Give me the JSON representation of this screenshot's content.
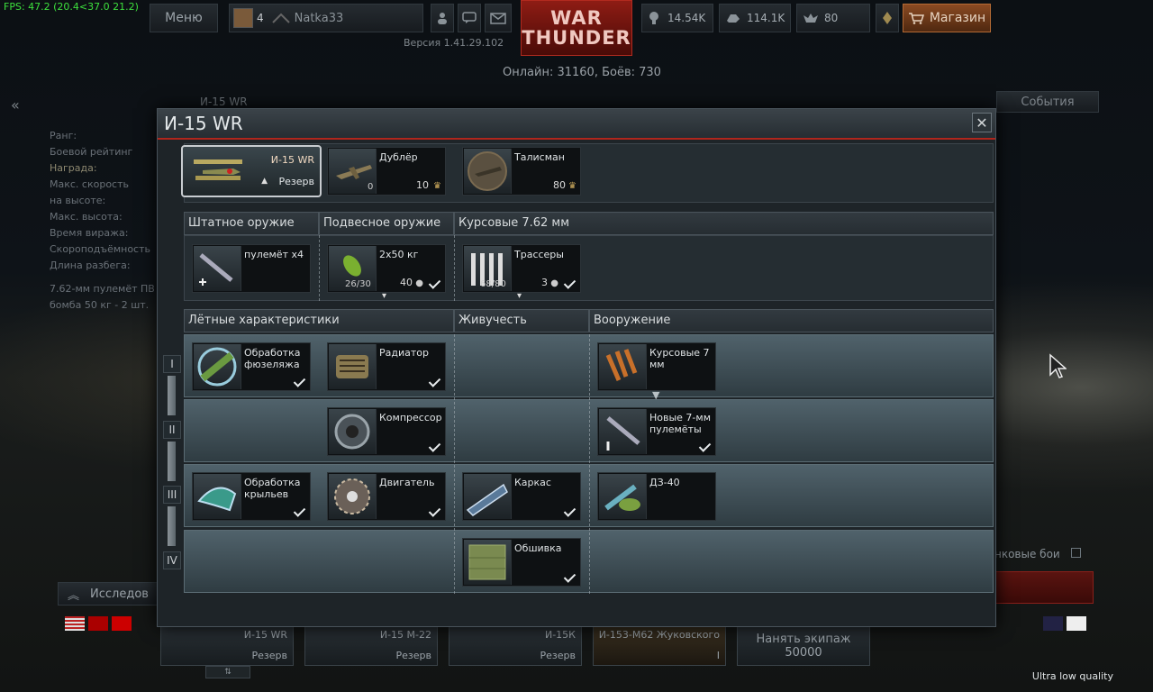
{
  "fps": "FPS: 47.2 (20.4<37.0 21.2)",
  "topbar": {
    "menu": "Меню",
    "rank": "4",
    "player": "Natka33",
    "silver": "14.54K",
    "rp": "114.1K",
    "gold": "80",
    "shop": "Магазин"
  },
  "logo": {
    "line1": "WAR",
    "line2": "THUNDER"
  },
  "version": "Версия 1.41.29.102",
  "online": "Онлайн: 31160, Боёв: 730",
  "background": {
    "breadcrumb": "И-15 WR",
    "events": "События",
    "left_labels": [
      "Ранг:",
      "Боевой рейтинг",
      "Награда:",
      "Макс. скорость",
      "на высоте:",
      "Макс. высота:",
      "Время виража:",
      "Скороподъёмность",
      "Длина разбега:"
    ],
    "left_note1": "7.62-мм пулемёт ПВ",
    "left_note2": "бомба 50 кг - 2 шт.",
    "research": "Исследов",
    "tank_battles": "нковые бои"
  },
  "modal": {
    "title": "И-15 WR",
    "vehicle": {
      "name": "И-15 WR",
      "status": "Резерв"
    },
    "crew": {
      "name": "Дублёр",
      "count": "0",
      "cost": "10"
    },
    "talisman": {
      "name": "Талисман",
      "cost": "80"
    },
    "weapons_headers": [
      "Штатное оружие",
      "Подвесное оружие",
      "Курсовые 7.62 мм"
    ],
    "weapons": {
      "primary": {
        "name": "пулемёт x4"
      },
      "bombs": {
        "name": "2x50 кг",
        "ammo": "26/30",
        "cost": "40"
      },
      "belts": {
        "name": "Трассеры",
        "ammo": "68/80",
        "cost": "3"
      }
    },
    "mod_headers": [
      "Лётные характеристики",
      "Живучесть",
      "Вооружение"
    ],
    "tiers": [
      "I",
      "II",
      "III",
      "IV"
    ],
    "mods": {
      "fuselage": "Обработка фюзеляжа",
      "radiator": "Радиатор",
      "guns7": "Курсовые 7 мм",
      "compressor": "Компрессор",
      "new_mg": "Новые 7-мм пулемёты",
      "wings": "Обработка крыльев",
      "engine": "Двигатель",
      "frame": "Каркас",
      "bomb_rack": "ДЗ-40",
      "cover": "Обшивка"
    }
  },
  "bottom": {
    "cards": [
      {
        "name": "И-15 WR",
        "status": "Резерв"
      },
      {
        "name": "И-15 М-22",
        "status": "Резерв"
      },
      {
        "name": "И-15К",
        "status": "Резерв"
      },
      {
        "name": "И-153-М62 Жуковского",
        "status": "I"
      }
    ],
    "hire_crew": "Нанять экипаж",
    "hire_cost": "50000"
  },
  "quality": "Ultra low quality"
}
